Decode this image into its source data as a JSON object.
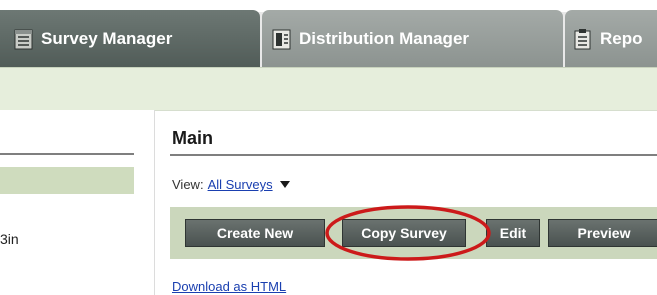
{
  "tabs": [
    {
      "label": "Survey Manager",
      "icon": "survey-list-icon"
    },
    {
      "label": "Distribution Manager",
      "icon": "distribution-icon"
    },
    {
      "label": "Repo",
      "icon": "reports-clipboard-icon"
    }
  ],
  "sidebar": {
    "item_label": "3in"
  },
  "main": {
    "title": "Main",
    "view_label": "View:",
    "view_value": "All Surveys",
    "buttons": {
      "create_new": "Create New",
      "copy_survey": "Copy Survey",
      "edit": "Edit",
      "preview": "Preview"
    },
    "download_link": "Download as HTML"
  },
  "colors": {
    "active_tab": "#5d6864",
    "inactive_tab": "#979e9b",
    "subband": "#e6eedc",
    "toolbar": "#cbd7bc",
    "highlight": "#cc1a1a",
    "link": "#1a3fb0"
  }
}
